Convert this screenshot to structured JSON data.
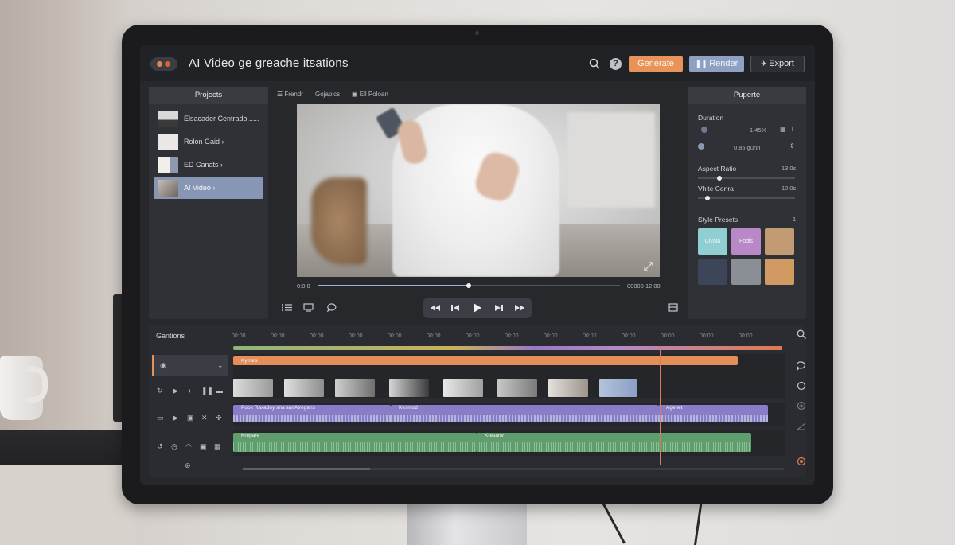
{
  "app": {
    "title": "AI Video ge greache itsations"
  },
  "header": {
    "buttons": {
      "generate": "Generate",
      "render": "Render",
      "export": "Export"
    },
    "icons": [
      "search-icon",
      "help-icon",
      "render-icon",
      "export-icon"
    ],
    "help_label": "?"
  },
  "projects_panel": {
    "title": "Projects",
    "items": [
      {
        "label": "Elsacader Centrado......",
        "active": false
      },
      {
        "label": "Rolon Gaid",
        "active": false
      },
      {
        "label": "ED Canats",
        "active": false
      },
      {
        "label": "AI Video",
        "active": true
      }
    ],
    "chevron": "›"
  },
  "center_toolbar": {
    "items": [
      "Frendr",
      "Gojapics",
      "Ell Poloan"
    ]
  },
  "player": {
    "time_start": "0:0:0",
    "time_end": "00000 12:00",
    "progress": 0.5
  },
  "properties_panel": {
    "title": "Puperte",
    "duration": {
      "label": "Duration",
      "row1_value": "1.45%",
      "row2_value": "0.85 gunn"
    },
    "aspect_ratio": {
      "label": "Aspect Ratio",
      "value": "13:0s",
      "level": 0.2
    },
    "white_contra": {
      "label": "Vhite Conra",
      "value": "10:0s",
      "level": 0.07
    },
    "style_presets": {
      "label": "Style Presets",
      "count": "1",
      "presets": [
        {
          "label": "Civaia",
          "color": "#8fcfd3"
        },
        {
          "label": "Fodis",
          "color": "#b889c6"
        },
        {
          "label": "",
          "color": "#c29a73"
        },
        {
          "label": "",
          "color": "#3d4658"
        },
        {
          "label": "",
          "color": "#8a8e96"
        },
        {
          "label": "",
          "color": "#d09a62"
        }
      ]
    }
  },
  "timeline": {
    "title": "Gantions",
    "ruler": [
      "00:00",
      "00:00",
      "00:00",
      "00:00",
      "00:00",
      "00:00",
      "00:00",
      "00:00",
      "00:00",
      "00:00",
      "00:00",
      "00:00",
      "00:00",
      "00:00"
    ],
    "clips": {
      "text_clip": "Kytrars",
      "audio_a": "Pook Raxadoy sna sarlAtregans",
      "audio_b": "Kesmod",
      "audio_c": "Agenet",
      "music_a": "Krepare",
      "music_b": "Kresanv"
    },
    "colors": {
      "accent_orange": "#e8935a",
      "accent_blue": "#8fa1c3",
      "clip_purple": "#8b7cc7",
      "clip_green": "#5f9c6e"
    }
  }
}
